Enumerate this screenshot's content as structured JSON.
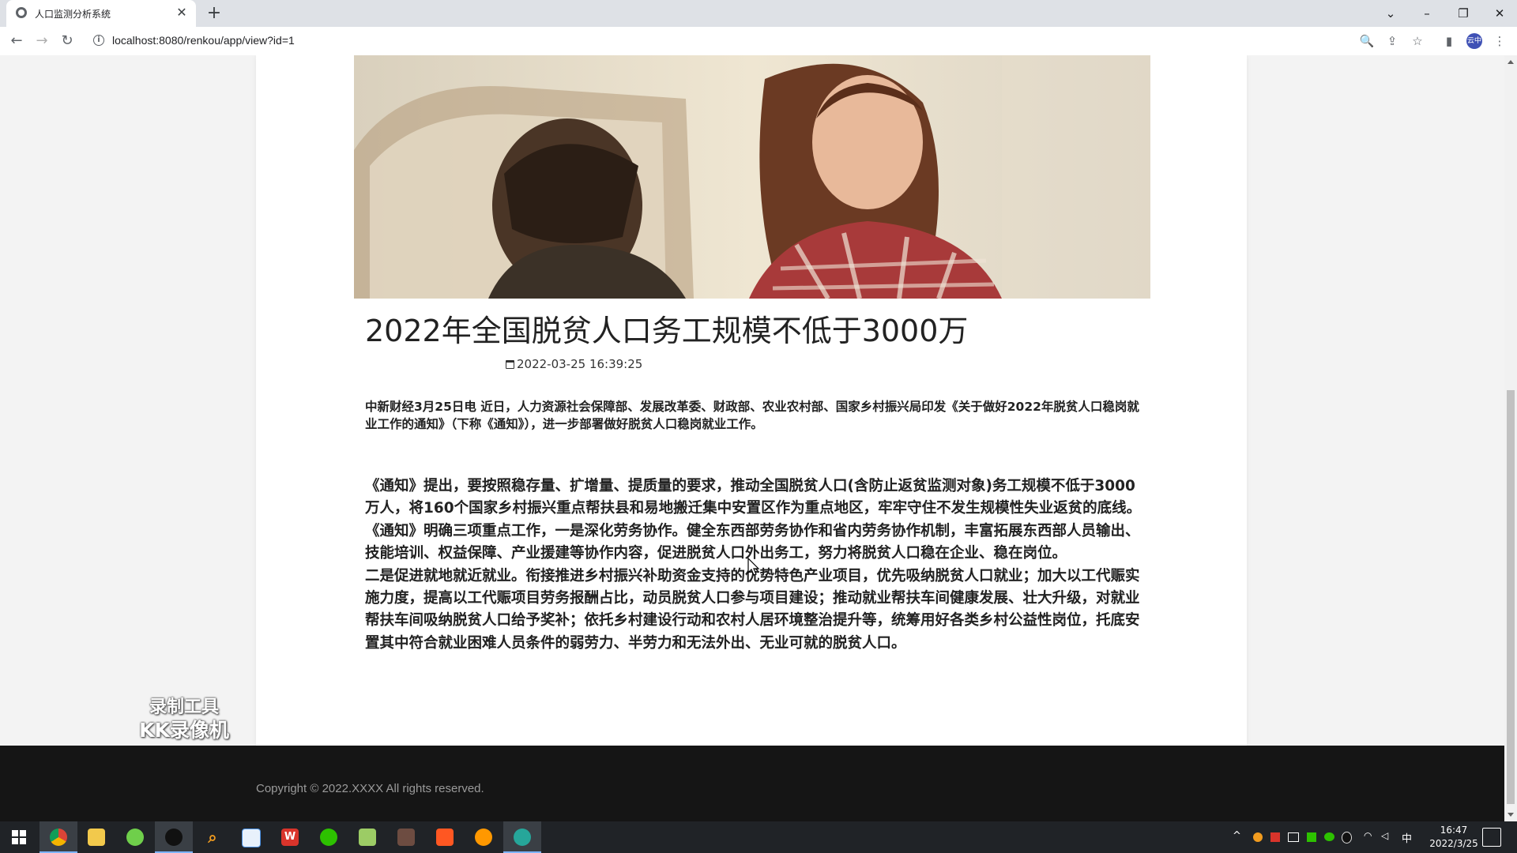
{
  "browser": {
    "tab_title": "人口监测分析系统",
    "tab_close": "✕",
    "new_tab": "+",
    "url": "localhost:8080/renkou/app/view?id=1",
    "profile_label": "云中",
    "window_controls": {
      "list": "⌄",
      "minimize": "–",
      "restore": "❐",
      "close": "✕"
    },
    "nav": {
      "back": "←",
      "forward": "→",
      "reload": "↻"
    },
    "toolbar_icons": {
      "zoom": "🔍",
      "share": "⇪",
      "bookmark": "☆",
      "sidepanel": "▮",
      "menu": "⋮"
    },
    "site_info_icon": "i"
  },
  "article": {
    "title": "2022年全国脱贫人口务工规模不低于3000万",
    "date": "2022-03-25 16:39:25",
    "lead": "中新财经3月25日电 近日，人力资源社会保障部、发展改革委、财政部、农业农村部、国家乡村振兴局印发《关于做好2022年脱贫人口稳岗就业工作的通知》（下称《通知》），进一步部署做好脱贫人口稳岗就业工作。",
    "paragraphs": [
      "《通知》提出，要按照稳存量、扩增量、提质量的要求，推动全国脱贫人口(含防止返贫监测对象)务工规模不低于3000万人，将160个国家乡村振兴重点帮扶县和易地搬迁集中安置区作为重点地区，牢牢守住不发生规模性失业返贫的底线。",
      "《通知》明确三项重点工作，一是深化劳务协作。健全东西部劳务协作和省内劳务协作机制，丰富拓展东西部人员输出、技能培训、权益保障、产业援建等协作内容，促进脱贫人口外出务工，努力将脱贫人口稳在企业、稳在岗位。",
      "二是促进就地就近就业。衔接推进乡村振兴补助资金支持的优势特色产业项目，优先吸纳脱贫人口就业；加大以工代赈实施力度，提高以工代赈项目劳务报酬占比，动员脱贫人口参与项目建设；推动就业帮扶车间健康发展、壮大升级，对就业帮扶车间吸纳脱贫人口给予奖补；依托乡村建设行动和农村人居环境整治提升等，统筹用好各类乡村公益性岗位，托底安置其中符合就业困难人员条件的弱劳力、半劳力和无法外出、无业可就的脱贫人口。"
    ]
  },
  "watermark": {
    "line1": "录制工具",
    "line2": "KK录像机"
  },
  "footer": {
    "copyright": "Copyright © 2022.XXXX All rights reserved."
  },
  "taskbar": {
    "apps": [
      "start",
      "chrome",
      "file-explorer",
      "green-app",
      "qq",
      "search-app",
      "paint-app",
      "wps",
      "wechat",
      "notepad",
      "game-app",
      "video-app",
      "firefox-app",
      "active-browser"
    ],
    "tray": {
      "chevron": "^",
      "ime": "中"
    },
    "time": "16:47",
    "date": "2022/3/25"
  }
}
